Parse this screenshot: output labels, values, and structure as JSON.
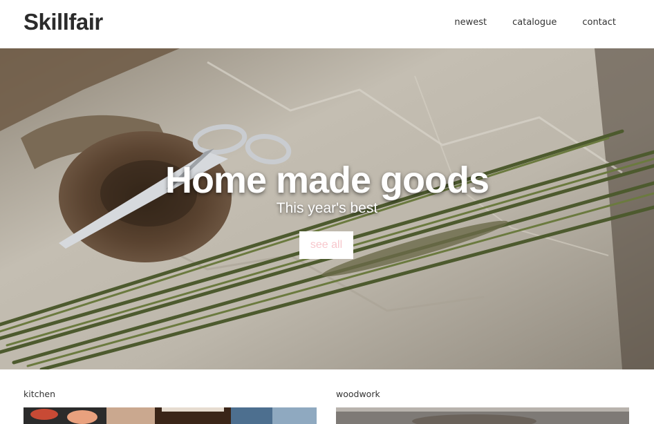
{
  "brand": {
    "name": "Skillfair"
  },
  "nav": {
    "items": [
      {
        "label": "newest"
      },
      {
        "label": "catalogue"
      },
      {
        "label": "contact"
      }
    ]
  },
  "hero": {
    "title": "Home made goods",
    "subtitle": "This year's best",
    "cta_label": "see all"
  },
  "categories": [
    {
      "label": "kitchen"
    },
    {
      "label": "woodwork"
    }
  ],
  "colors": {
    "cta_text": "#f7c7cc",
    "text_dark": "#2b2b2b"
  }
}
